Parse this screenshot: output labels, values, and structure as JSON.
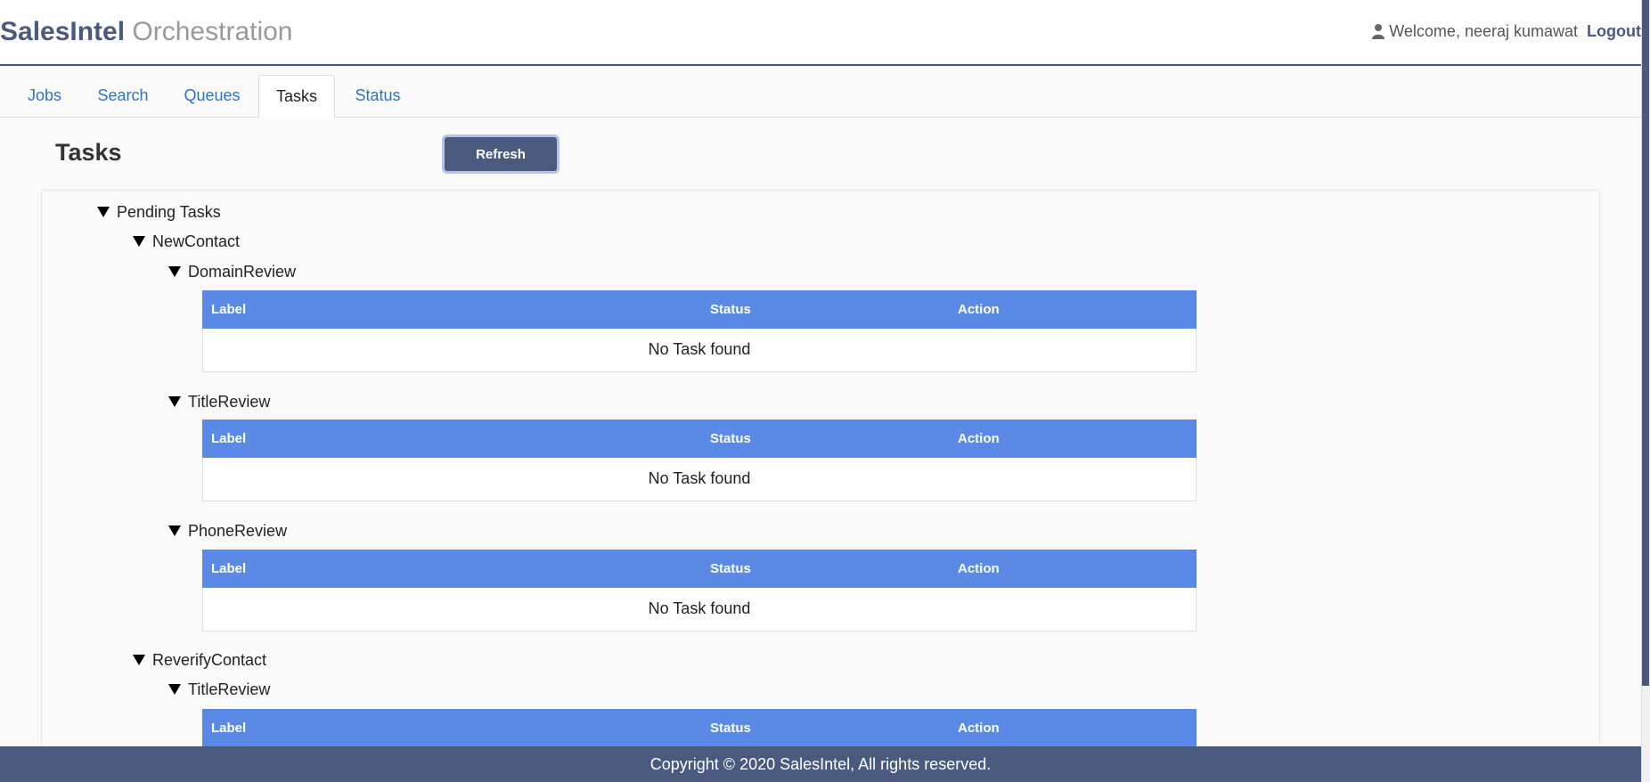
{
  "brand": {
    "name": "SalesIntel",
    "suffix": "Orchestration"
  },
  "user": {
    "welcome": "Welcome, neeraj kumawat",
    "logout_label": "Logout"
  },
  "tabs": [
    {
      "label": "Jobs"
    },
    {
      "label": "Search"
    },
    {
      "label": "Queues"
    },
    {
      "label": "Tasks",
      "active": true
    },
    {
      "label": "Status"
    }
  ],
  "page": {
    "title": "Tasks",
    "refresh_label": "Refresh"
  },
  "tree": {
    "root": "Pending Tasks",
    "groups": [
      {
        "label": "NewContact",
        "reviews": [
          {
            "label": "DomainReview",
            "empty_text": "No Task found"
          },
          {
            "label": "TitleReview",
            "empty_text": "No Task found"
          },
          {
            "label": "PhoneReview",
            "empty_text": "No Task found"
          }
        ]
      },
      {
        "label": "ReverifyContact",
        "reviews": [
          {
            "label": "TitleReview"
          }
        ]
      }
    ]
  },
  "table_headers": {
    "label": "Label",
    "status": "Status",
    "action": "Action"
  },
  "footer": {
    "text": "Copyright © 2020 SalesIntel, All rights reserved."
  },
  "colors": {
    "brand": "#4a5a7e",
    "table_header": "#5a8ae6",
    "link": "#2a73c9"
  }
}
